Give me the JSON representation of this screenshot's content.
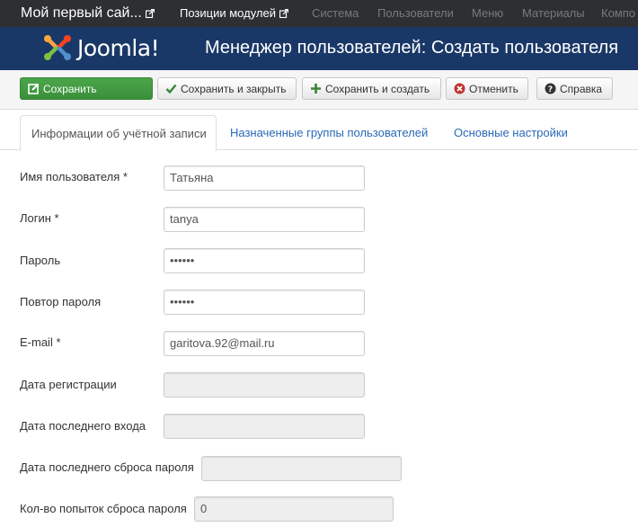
{
  "topnav": {
    "site_title": "Мой первый сай...",
    "module_positions": "Позиции модулей",
    "items": [
      "Система",
      "Пользователи",
      "Меню",
      "Материалы",
      "Компо"
    ]
  },
  "header": {
    "logo_text": "Joomla!",
    "title": "Менеджер пользователей: Создать пользователя"
  },
  "toolbar": {
    "save": "Сохранить",
    "save_close": "Сохранить и закрыть",
    "save_new": "Сохранить и создать",
    "cancel": "Отменить",
    "help": "Справка"
  },
  "tabs": [
    "Информации об учётной записи",
    "Назначенные группы пользователей",
    "Основные настройки"
  ],
  "form": {
    "name": {
      "label": "Имя пользователя *",
      "value": "Татьяна"
    },
    "login": {
      "label": "Логин *",
      "value": "tanya"
    },
    "password": {
      "label": "Пароль",
      "value": "••••••"
    },
    "password2": {
      "label": "Повтор пароля",
      "value": "••••••"
    },
    "email": {
      "label": "E-mail *",
      "value": "garitova.92@mail.ru"
    },
    "register_date": {
      "label": "Дата регистрации",
      "value": ""
    },
    "last_visit": {
      "label": "Дата последнего входа",
      "value": ""
    },
    "last_reset": {
      "label": "Дата последнего сброса пароля",
      "value": ""
    },
    "reset_count": {
      "label": "Кол-во попыток сброса пароля",
      "value": "0"
    }
  },
  "colors": {
    "topnav_bg": "#2d2f31",
    "header_bg": "#1a3867",
    "save_button": "#46a546",
    "link": "#2a69b8"
  }
}
